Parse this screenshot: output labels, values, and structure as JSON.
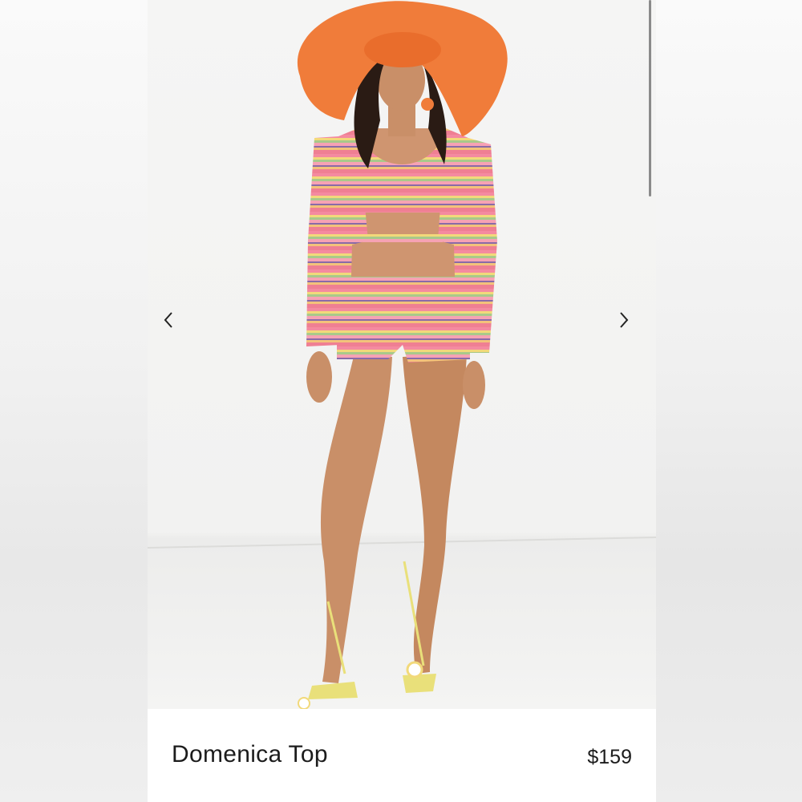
{
  "product": {
    "name": "Domenica Top",
    "price": "$159"
  },
  "carousel": {
    "prev_icon": "chevron-left-icon",
    "next_icon": "chevron-right-icon"
  },
  "colors": {
    "hat": "#f07c3a",
    "stripe_pink": "#f48aa0",
    "stripe_yellow": "#f2d97a",
    "stripe_green": "#a9c98a",
    "skin": "#c98f68",
    "sandal": "#e9e07a"
  }
}
